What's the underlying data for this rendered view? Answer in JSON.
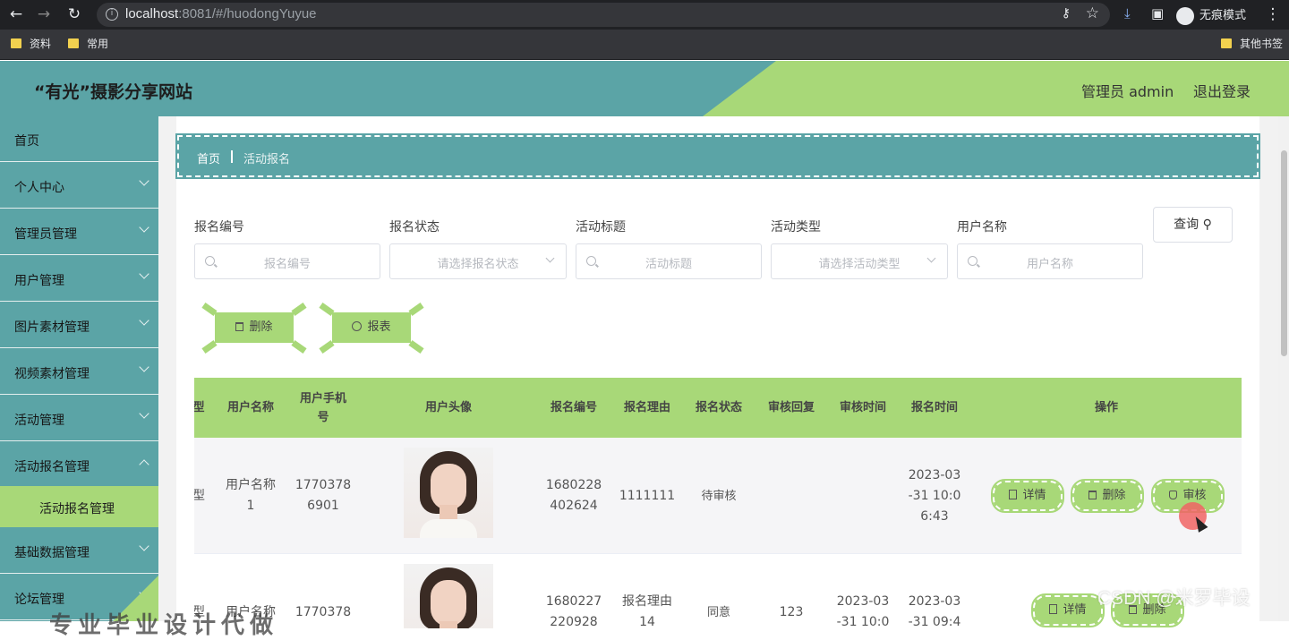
{
  "browser": {
    "url_host": "localhost",
    "url_rest": ":8081/#/huodongYuyue",
    "incognito_label": "无痕模式",
    "bookmarks": [
      "资料",
      "常用"
    ],
    "other_bookmarks": "其他书签"
  },
  "header": {
    "title": "“有光”摄影分享网站",
    "admin_label": "管理员 admin",
    "logout_label": "退出登录"
  },
  "sidebar": {
    "items": [
      {
        "label": "首页"
      },
      {
        "label": "个人中心"
      },
      {
        "label": "管理员管理"
      },
      {
        "label": "用户管理"
      },
      {
        "label": "图片素材管理"
      },
      {
        "label": "视频素材管理"
      },
      {
        "label": "活动管理"
      },
      {
        "label": "活动报名管理"
      },
      {
        "label": "基础数据管理"
      },
      {
        "label": "论坛管理"
      }
    ],
    "active_sub": "活动报名管理"
  },
  "breadcrumb": {
    "home": "首页",
    "current": "活动报名"
  },
  "filters": [
    {
      "label": "报名编号",
      "placeholder": "报名编号",
      "type": "text"
    },
    {
      "label": "报名状态",
      "placeholder": "请选择报名状态",
      "type": "select"
    },
    {
      "label": "活动标题",
      "placeholder": "活动标题",
      "type": "text"
    },
    {
      "label": "活动类型",
      "placeholder": "请选择活动类型",
      "type": "select"
    },
    {
      "label": "用户名称",
      "placeholder": "用户名称",
      "type": "text"
    }
  ],
  "query_label": "查询",
  "actions": {
    "delete_label": "删除",
    "report_label": "报表"
  },
  "table": {
    "headers": [
      "型",
      "用户名称",
      "用户手机\n号",
      "用户头像",
      "报名编号",
      "报名理由",
      "报名状态",
      "审核回复",
      "审核时间",
      "报名时间",
      "操作"
    ],
    "rows": [
      {
        "type": "型",
        "user": "用户名称\n1",
        "phone": "1770378\n6901",
        "code": "1680228\n402624",
        "reason": "1111111",
        "status": "待审核",
        "reply": "",
        "audit_time": "",
        "signup_time": "2023-03\n-31 10:0\n6:43",
        "ops": [
          "详情",
          "删除",
          "审核"
        ]
      },
      {
        "type": "型",
        "user": "用户名称",
        "phone": "1770378",
        "code": "1680227\n220928",
        "reason": "报名理由\n14",
        "status": "同意",
        "reply": "123",
        "audit_time": "2023-03\n-31 10:0",
        "signup_time": "2023-03\n-31 09:4",
        "ops": [
          "详情",
          "删除"
        ]
      }
    ]
  },
  "watermark": "CSDN @米罗毕设",
  "bottom_overlay": "专业毕业设计代做",
  "colors": {
    "teal": "#5ba4a6",
    "green": "#a8d878"
  }
}
